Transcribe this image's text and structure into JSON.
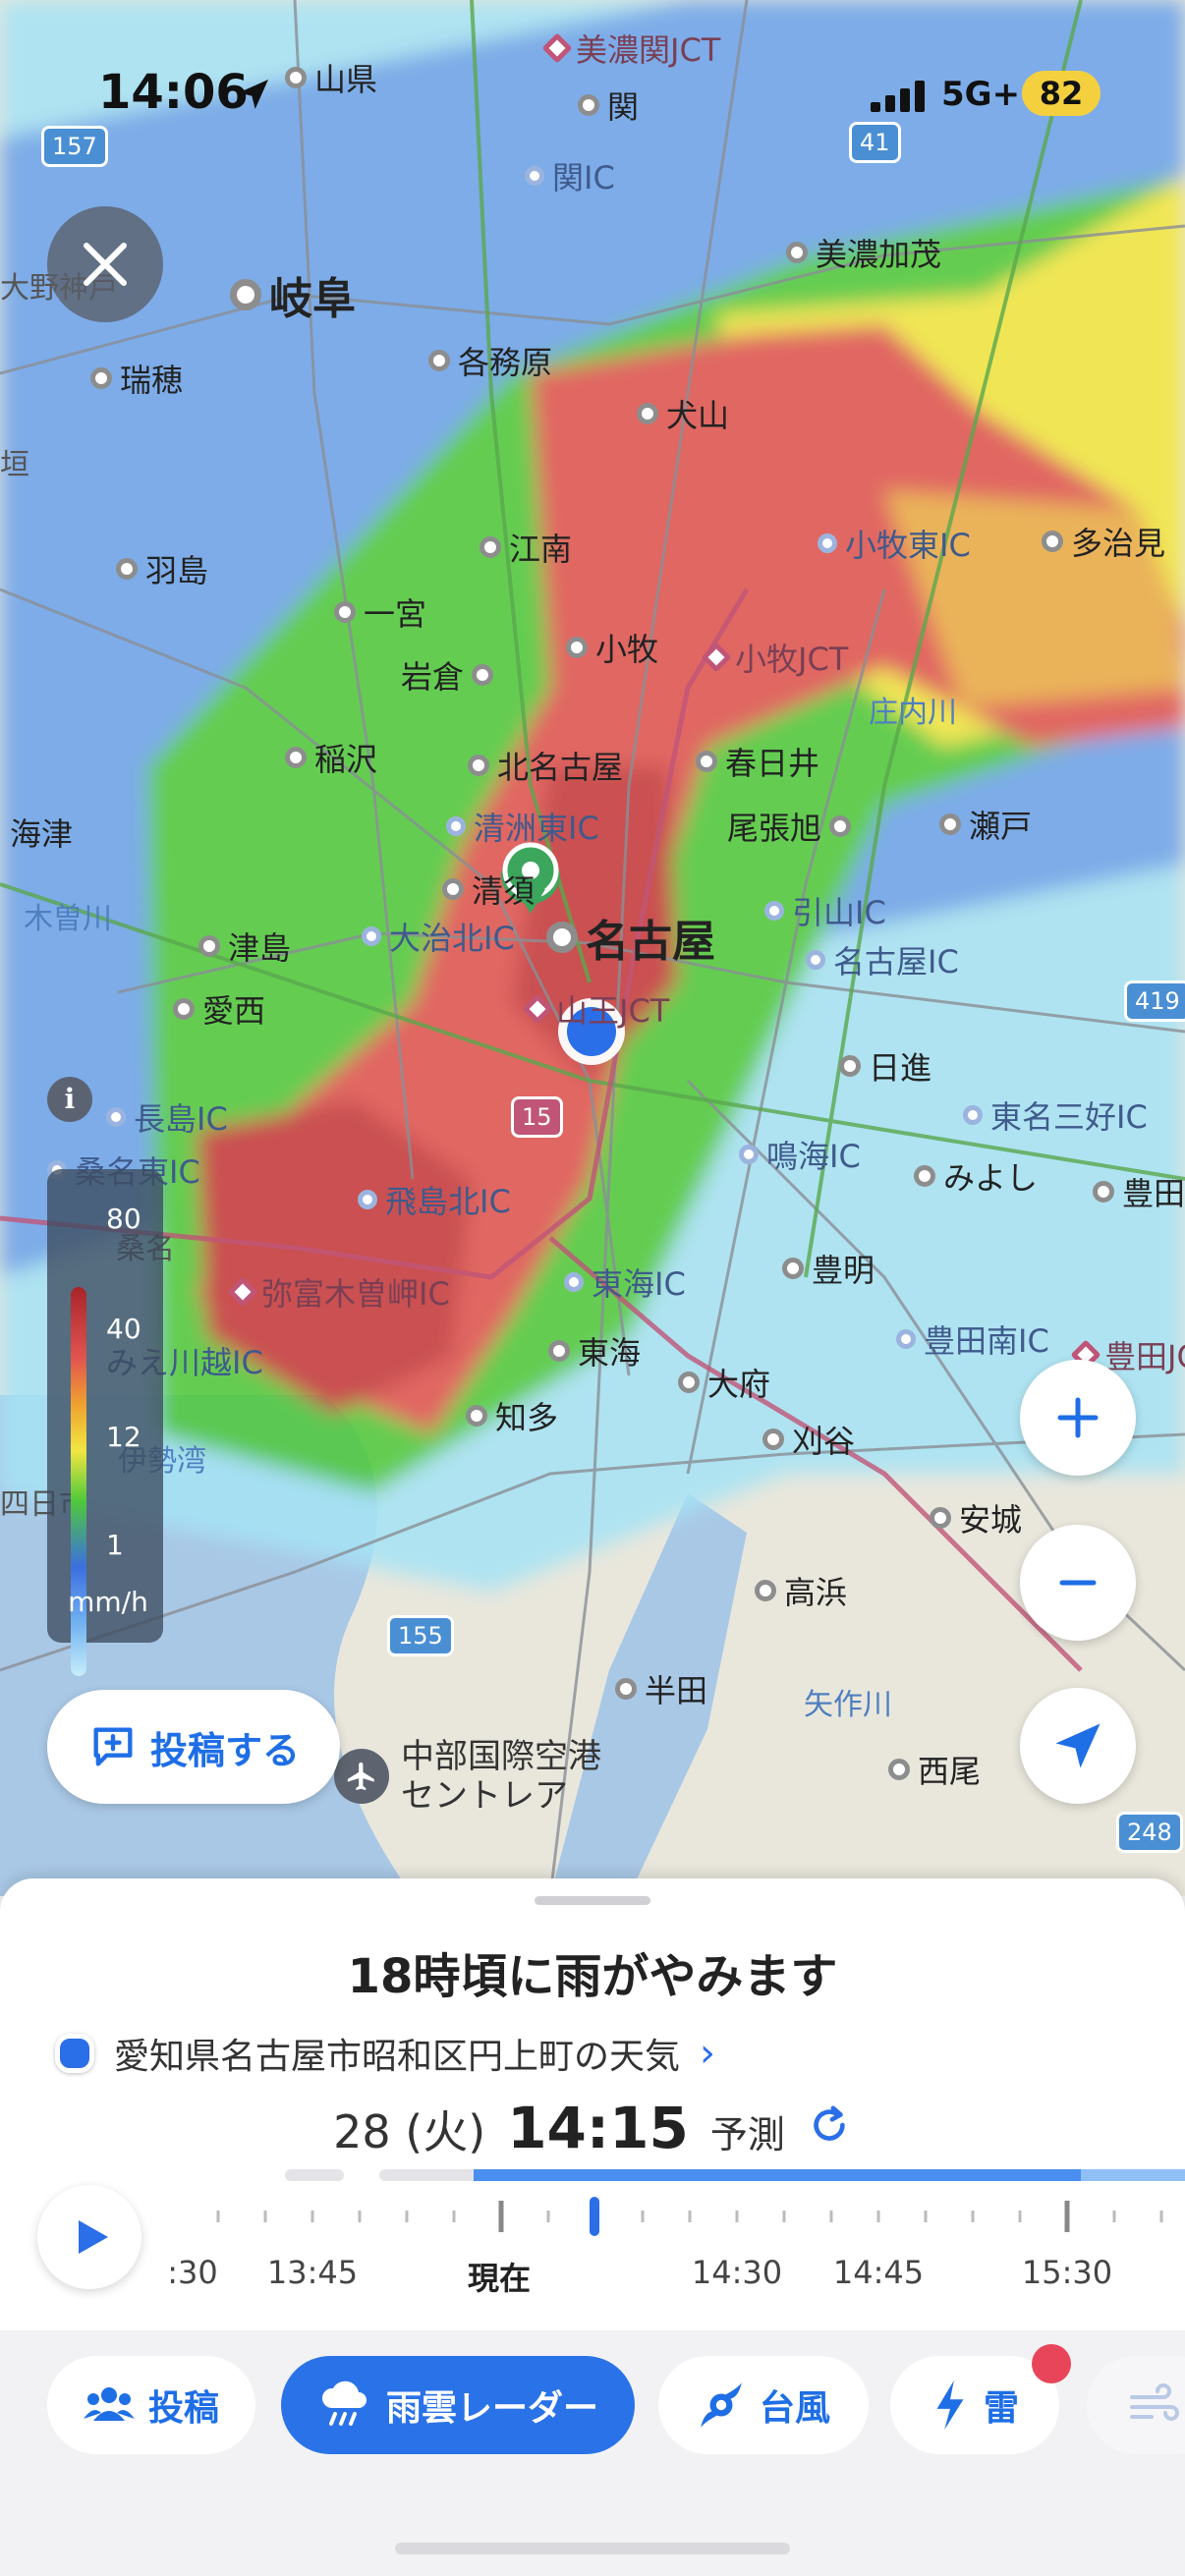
{
  "status_bar": {
    "time": "14:06",
    "network": "5G+",
    "battery": "82"
  },
  "map": {
    "places_big": [
      "岐阜",
      "名古屋"
    ],
    "places": [
      "山県",
      "関",
      "美濃加茂",
      "各務原",
      "瑞穂",
      "犬山",
      "江南",
      "羽島",
      "一宮",
      "小牧",
      "多治見",
      "岩倉",
      "稲沢",
      "北名古屋",
      "春日井",
      "尾張旭",
      "瀬戸",
      "海津",
      "清須",
      "津島",
      "愛西",
      "日進",
      "みよし",
      "豊田",
      "豊明",
      "東海",
      "大府",
      "知多",
      "刈谷",
      "安城",
      "高浜",
      "半田",
      "西尾",
      "桑名",
      "大野神戸",
      "垣",
      "四日市"
    ],
    "ics": [
      "美濃関JCT",
      "関IC",
      "小牧東IC",
      "小牧JCT",
      "清洲東IC",
      "大治北IC",
      "引山IC",
      "名古屋IC",
      "山王JCT",
      "長島IC",
      "桑名東IC",
      "飛島北IC",
      "弥富木曽岬IC",
      "鳴海IC",
      "東海IC",
      "東名三好IC",
      "豊田南IC",
      "豊田JCT",
      "みえ川越IC"
    ],
    "water_labels": [
      "木曽川",
      "庄内川",
      "伊勢湾",
      "矢作川"
    ],
    "road_badges": [
      "157",
      "41",
      "419",
      "155",
      "248",
      "155",
      "15"
    ],
    "airport": {
      "line1": "中部国際空港",
      "line2": "セントレア"
    },
    "legend": {
      "levels": [
        "80",
        "40",
        "12",
        "1"
      ],
      "unit": "mm/h"
    },
    "post_button": "投稿する",
    "rain_colors": {
      "light": "#a6e3f5",
      "blue": "#3c6fe0",
      "green": "#4fc93a",
      "yellow": "#f2e640",
      "red": "#e0534f",
      "dark_red": "#a7252b"
    },
    "icons": {
      "close": "close-icon",
      "zoom_in": "plus-icon",
      "zoom_out": "minus-icon",
      "locate": "location-arrow-icon",
      "info": "info-icon",
      "post": "chat-plus-icon",
      "play": "play-icon",
      "refresh": "refresh-icon",
      "pin": "map-pin-icon"
    }
  },
  "sheet": {
    "headline": "18時頃に雨がやみます",
    "location": "愛知県名古屋市昭和区円上町の天気",
    "date": "28 (火)",
    "time": "14:15",
    "mode": "予測",
    "timeline": {
      "labels": [
        ":30",
        "13:45",
        "現在",
        "14:30",
        "14:45",
        "15:30",
        ""
      ],
      "current_label": "現在",
      "progress_note": "予測"
    }
  },
  "tabs": [
    {
      "label": "投稿",
      "icon": "people-icon"
    },
    {
      "label": "雨雲レーダー",
      "icon": "rain-cloud-icon"
    },
    {
      "label": "台風",
      "icon": "typhoon-icon"
    },
    {
      "label": "雷",
      "icon": "lightning-icon"
    },
    {
      "label": "",
      "icon": "wind-icon"
    }
  ]
}
